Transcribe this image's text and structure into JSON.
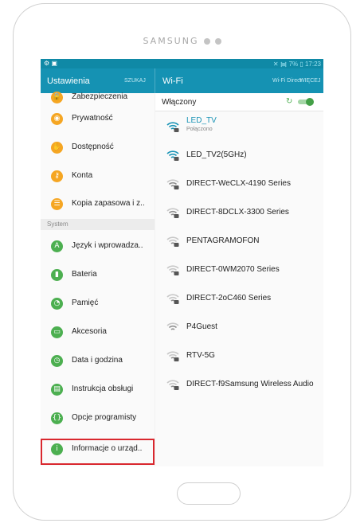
{
  "device": {
    "brand": "SAMSUNG"
  },
  "statusbar": {
    "indicators": "7% ▯ 17:23"
  },
  "settings": {
    "title": "Ustawienia",
    "search_label": "SZUKAJ",
    "section_system": "System",
    "items": [
      {
        "label": "Zabezpieczenia",
        "icon": "lock-icon",
        "color": "#f5a623"
      },
      {
        "label": "Prywatność",
        "icon": "privacy-icon",
        "color": "#f5a623"
      },
      {
        "label": "Dostępność",
        "icon": "accessibility-icon",
        "color": "#f5a623"
      },
      {
        "label": "Konta",
        "icon": "key-icon",
        "color": "#f5a623"
      },
      {
        "label": "Kopia zapasowa i z..",
        "icon": "backup-icon",
        "color": "#f5a623"
      },
      {
        "label": "Język i wprowadza..",
        "icon": "language-icon",
        "color": "#4caf50"
      },
      {
        "label": "Bateria",
        "icon": "battery-icon",
        "color": "#4caf50"
      },
      {
        "label": "Pamięć",
        "icon": "storage-icon",
        "color": "#4caf50"
      },
      {
        "label": "Akcesoria",
        "icon": "accessories-icon",
        "color": "#4caf50"
      },
      {
        "label": "Data i godzina",
        "icon": "clock-icon",
        "color": "#4caf50"
      },
      {
        "label": "Instrukcja obsługi",
        "icon": "manual-icon",
        "color": "#4caf50"
      },
      {
        "label": "Opcje programisty",
        "icon": "developer-icon",
        "color": "#4caf50"
      },
      {
        "label": "Informacje o urząd..",
        "icon": "info-icon",
        "color": "#4caf50"
      }
    ]
  },
  "wifi": {
    "title": "Wi-Fi",
    "wifi_direct": "Wi-Fi Direct",
    "more": "WIĘCEJ",
    "switch_label": "Włączony",
    "networks": [
      {
        "name": "LED_TV",
        "status": "Połączono",
        "locked": true,
        "signal": "strong"
      },
      {
        "name": "LED_TV2(5GHz)",
        "locked": true,
        "signal": "strong"
      },
      {
        "name": "DIRECT-WeCLX-4190 Series",
        "locked": true,
        "signal": "medium"
      },
      {
        "name": "DIRECT-8DCLX-3300 Series",
        "locked": true,
        "signal": "medium"
      },
      {
        "name": "PENTAGRAMOFON",
        "locked": true,
        "signal": "weak"
      },
      {
        "name": "DIRECT-0WM2070 Series",
        "locked": true,
        "signal": "weak"
      },
      {
        "name": "DIRECT-2oC460 Series",
        "locked": true,
        "signal": "weak"
      },
      {
        "name": "P4Guest",
        "locked": false,
        "signal": "medium"
      },
      {
        "name": "RTV-5G",
        "locked": true,
        "signal": "weak"
      },
      {
        "name": "DIRECT-f9Samsung Wireless Audio",
        "locked": true,
        "signal": "weak"
      }
    ]
  },
  "colors": {
    "accent": "#1592b3",
    "connected": "#1b94b6",
    "toggle_on": "#43a047",
    "highlight": "#d9272e"
  }
}
